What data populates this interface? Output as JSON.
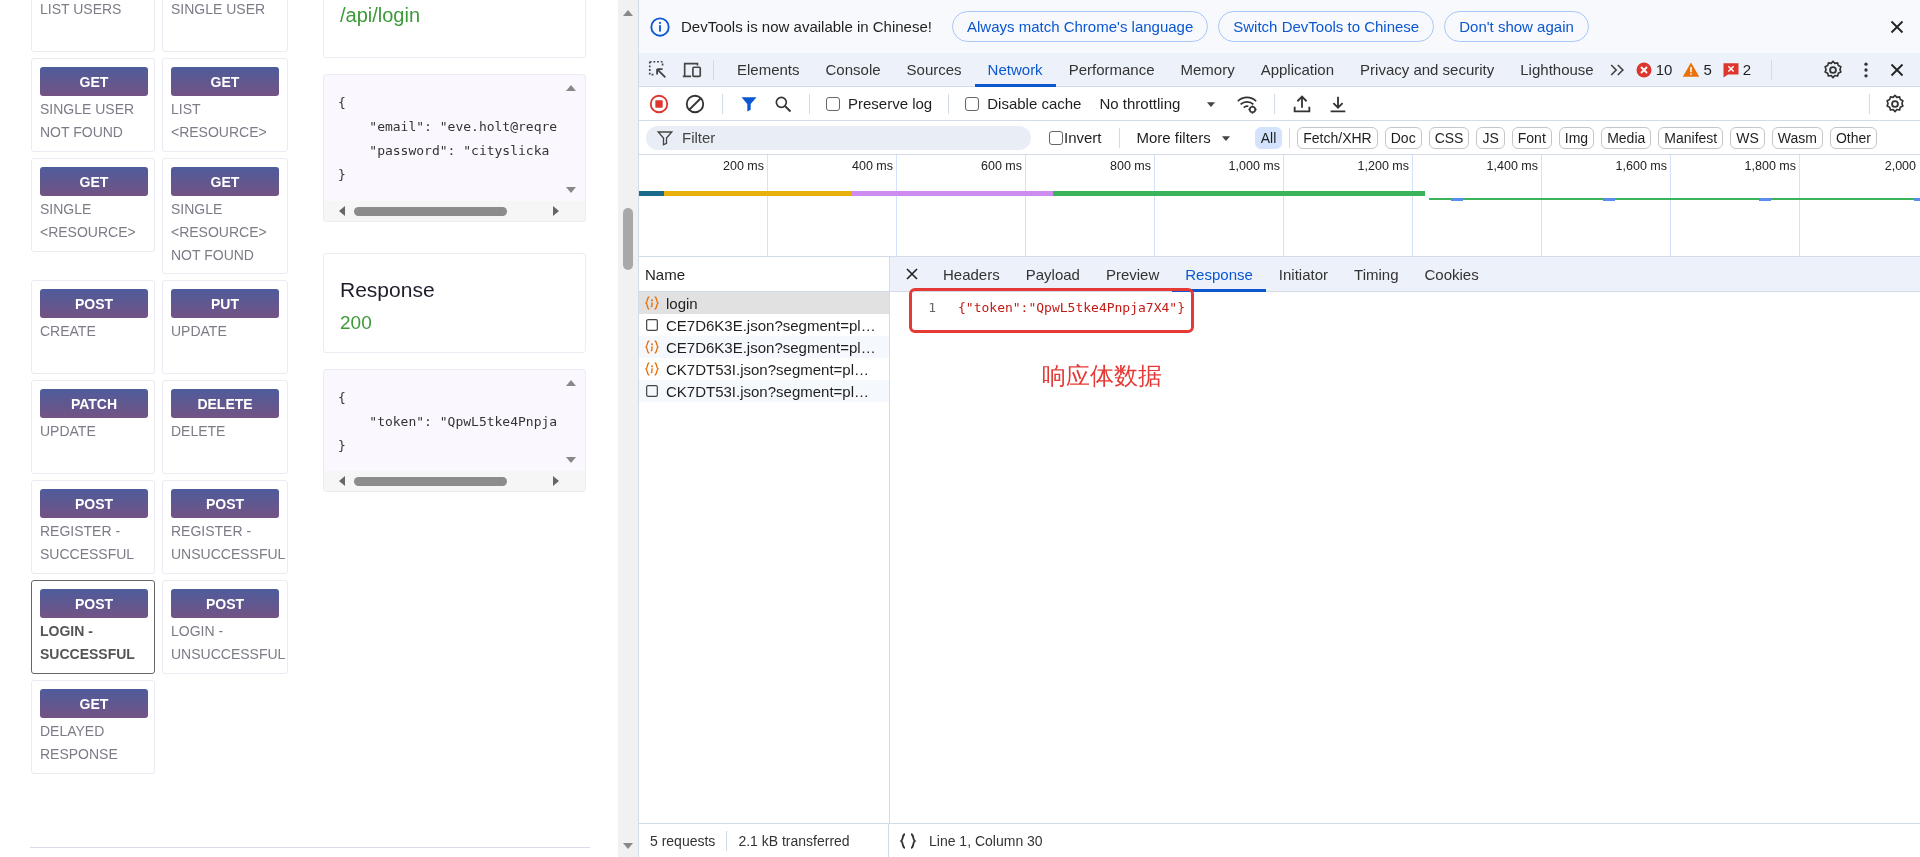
{
  "api_page": {
    "endpoints": [
      {
        "label": "LIST USERS",
        "selected": false
      },
      {
        "label": "SINGLE USER",
        "selected": false
      },
      {
        "method": "GET",
        "label": "SINGLE USER\nNOT FOUND",
        "selected": false
      },
      {
        "method": "GET",
        "label": "LIST\n<RESOURCE>",
        "selected": false
      },
      {
        "method": "GET",
        "label": "SINGLE\n<RESOURCE>",
        "selected": false
      },
      {
        "method": "GET",
        "label": "SINGLE\n<RESOURCE>\nNOT FOUND",
        "selected": false
      },
      {
        "method": "POST",
        "label": "CREATE",
        "selected": false
      },
      {
        "method": "PUT",
        "label": "UPDATE",
        "selected": false
      },
      {
        "method": "PATCH",
        "label": "UPDATE",
        "selected": false
      },
      {
        "method": "DELETE",
        "label": "DELETE",
        "selected": false
      },
      {
        "method": "POST",
        "label": "REGISTER -\nSUCCESSFUL",
        "selected": false
      },
      {
        "method": "POST",
        "label": "REGISTER -\nUNSUCCESSFUL",
        "selected": false
      },
      {
        "method": "POST",
        "label": "LOGIN -\nSUCCESSFUL",
        "selected": true
      },
      {
        "method": "POST",
        "label": "LOGIN -\nUNSUCCESSFUL",
        "selected": false
      },
      {
        "method": "GET",
        "label": "DELAYED\nRESPONSE",
        "selected": false
      }
    ],
    "request": {
      "url": "/api/login",
      "body": [
        "{",
        "    \"email\": \"eve.holt@reqre",
        "    \"password\": \"cityslicka",
        "}"
      ]
    },
    "response": {
      "title": "Response",
      "status": "200",
      "body": [
        "{",
        "    \"token\": \"QpwL5tke4Pnpja",
        "}"
      ]
    }
  },
  "devtools": {
    "banner": {
      "message": "DevTools is now available in Chinese!",
      "buttons": [
        "Always match Chrome's language",
        "Switch DevTools to Chinese",
        "Don't show again"
      ]
    },
    "tabs": [
      {
        "label": "Elements",
        "selected": false
      },
      {
        "label": "Console",
        "selected": false
      },
      {
        "label": "Sources",
        "selected": false
      },
      {
        "label": "Network",
        "selected": true
      },
      {
        "label": "Performance",
        "selected": false
      },
      {
        "label": "Memory",
        "selected": false
      },
      {
        "label": "Application",
        "selected": false
      },
      {
        "label": "Privacy and security",
        "selected": false
      },
      {
        "label": "Lighthouse",
        "selected": false
      }
    ],
    "counters": {
      "errors": "10",
      "warnings": "5",
      "issues": "2"
    },
    "toolbar": {
      "preserve_log": {
        "label": "Preserve log",
        "checked": false
      },
      "disable_cache": {
        "label": "Disable cache",
        "checked": false
      },
      "throttling": "No throttling"
    },
    "filter": {
      "placeholder": "Filter",
      "invert": {
        "label": "Invert",
        "checked": false
      },
      "more_filters": "More filters",
      "types": [
        {
          "label": "All",
          "selected": true
        },
        {
          "label": "Fetch/XHR",
          "selected": false
        },
        {
          "label": "Doc",
          "selected": false
        },
        {
          "label": "CSS",
          "selected": false
        },
        {
          "label": "JS",
          "selected": false
        },
        {
          "label": "Font",
          "selected": false
        },
        {
          "label": "Img",
          "selected": false
        },
        {
          "label": "Media",
          "selected": false
        },
        {
          "label": "Manifest",
          "selected": false
        },
        {
          "label": "WS",
          "selected": false
        },
        {
          "label": "Wasm",
          "selected": false
        },
        {
          "label": "Other",
          "selected": false
        }
      ]
    },
    "timeline": {
      "ticks": [
        "200 ms",
        "400 ms",
        "600 ms",
        "800 ms",
        "1,000 ms",
        "1,200 ms",
        "1,400 ms",
        "1,600 ms",
        "1,800 ms",
        "2,000"
      ]
    },
    "requests": {
      "column": "Name",
      "items": [
        {
          "name": "login",
          "kind": "fetch",
          "selected": true
        },
        {
          "name": "CE7D6K3E.json?segment=pl…",
          "kind": "document",
          "selected": false
        },
        {
          "name": "CE7D6K3E.json?segment=pl…",
          "kind": "fetch",
          "selected": false
        },
        {
          "name": "CK7DT53I.json?segment=pl…",
          "kind": "fetch",
          "selected": false
        },
        {
          "name": "CK7DT53I.json?segment=pl…",
          "kind": "document",
          "selected": false
        }
      ]
    },
    "detail": {
      "tabs": [
        {
          "label": "Headers",
          "selected": false
        },
        {
          "label": "Payload",
          "selected": false
        },
        {
          "label": "Preview",
          "selected": false
        },
        {
          "label": "Response",
          "selected": true
        },
        {
          "label": "Initiator",
          "selected": false
        },
        {
          "label": "Timing",
          "selected": false
        },
        {
          "label": "Cookies",
          "selected": false
        }
      ],
      "response": {
        "line_number": "1",
        "code": "{\"token\":\"QpwL5tke4Pnpja7X4\"}"
      },
      "annotation": "响应体数据"
    },
    "status": {
      "requests": "5 requests",
      "transferred": "2.1 kB transferred",
      "position": "Line 1, Column 30"
    }
  }
}
